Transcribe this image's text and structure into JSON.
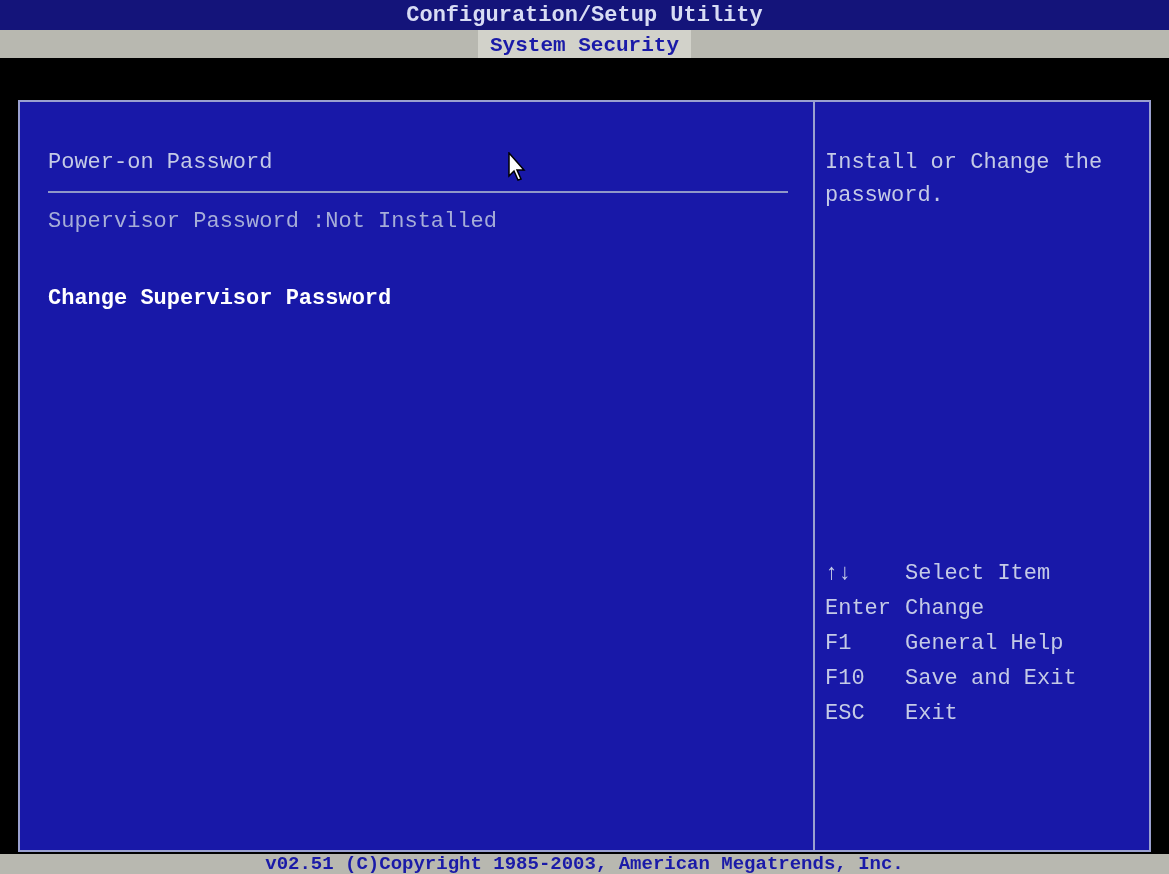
{
  "title": "Configuration/Setup Utility",
  "tabs": [
    {
      "label": "System Security",
      "selected": true
    }
  ],
  "items": [
    {
      "kind": "heading",
      "label": "Power-on Password"
    },
    {
      "kind": "status",
      "label": "Supervisor Password :Not Installed"
    },
    {
      "kind": "action",
      "label": "Change Supervisor Password",
      "selected": true
    }
  ],
  "help": "Install or Change the password.",
  "keys": [
    {
      "key": "↑↓",
      "action": "Select Item"
    },
    {
      "key": "Enter",
      "action": "Change"
    },
    {
      "key": "F1",
      "action": "General Help"
    },
    {
      "key": "F10",
      "action": "Save and Exit"
    },
    {
      "key": "ESC",
      "action": "Exit"
    }
  ],
  "footer": "v02.51 (C)Copyright 1985-2003, American Megatrends, Inc."
}
